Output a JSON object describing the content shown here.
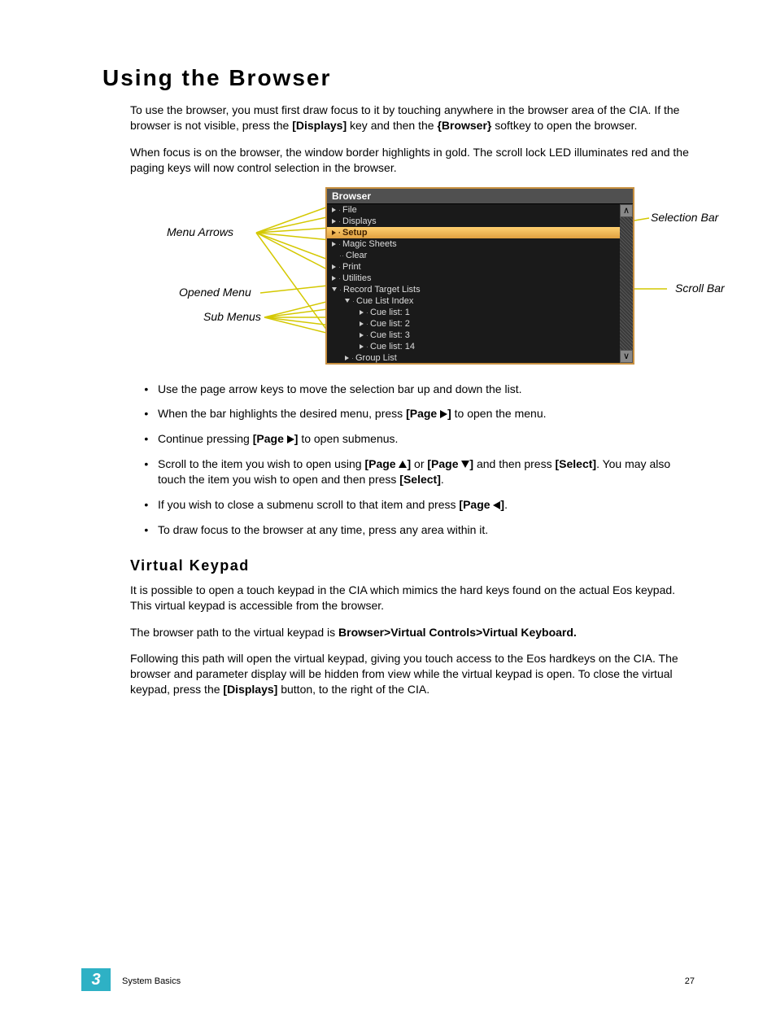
{
  "heading": "Using the Browser",
  "para1_a": "To use the browser, you must first draw focus to it by touching anywhere in the browser area of the CIA. If the browser is not visible, press the ",
  "para1_b": "[Displays]",
  "para1_c": " key and then the ",
  "para1_d": "{Browser}",
  "para1_e": " softkey to open the browser.",
  "para2": "When focus is on the browser, the window border highlights in gold. The scroll lock LED illuminates red and the paging keys will now control selection in the browser.",
  "callouts": {
    "menu_arrows": "Menu Arrows",
    "opened_menu": "Opened Menu",
    "sub_menus": "Sub Menus",
    "selection_bar": "Selection Bar",
    "scroll_bar": "Scroll Bar"
  },
  "browser": {
    "title": "Browser",
    "rows": [
      "File",
      "Displays",
      "Setup",
      "Magic Sheets",
      "Clear",
      "Print",
      "Utilities",
      "Record Target Lists",
      "Cue List Index",
      "Cue list: 1",
      "Cue list: 2",
      "Cue list: 3",
      "Cue list: 14",
      "Group List"
    ]
  },
  "bullets": {
    "b1": "Use the page arrow keys to move the selection bar up and down the list.",
    "b2_a": "When the bar highlights the desired menu, press ",
    "b2_b": "[Page ",
    "b2_c": "]",
    "b2_d": " to open the menu.",
    "b3_a": "Continue pressing ",
    "b3_b": "[Page ",
    "b3_c": "]",
    "b3_d": " to open submenus.",
    "b4_a": "Scroll to the item you wish to open using ",
    "b4_b": "[Page ",
    "b4_c": "]",
    "b4_d": " or ",
    "b4_e": "[Page ",
    "b4_f": "]",
    "b4_g": " and then press ",
    "b4_h": "[Select]",
    "b4_i": ". You may also touch the item you wish to open and then press ",
    "b4_j": "[Select]",
    "b4_k": ".",
    "b5_a": "If you wish to close a submenu scroll to that item and press ",
    "b5_b": "[Page ",
    "b5_c": "]",
    "b5_d": ".",
    "b6": "To draw focus to the browser at any time, press any area within it."
  },
  "sub_heading": "Virtual Keypad",
  "vk_p1": "It is possible to open a touch keypad in the CIA which mimics the hard keys found on the actual Eos keypad. This virtual keypad is accessible from the browser.",
  "vk_p2_a": "The browser path to the virtual keypad is ",
  "vk_p2_b": "Browser>Virtual Controls>Virtual Keyboard.",
  "vk_p3_a": "Following this path will open the virtual keypad, giving you touch access to the Eos hardkeys on the CIA. The browser and parameter display will be hidden from view while the virtual keypad is open. To close the virtual keypad, press the ",
  "vk_p3_b": "[Displays]",
  "vk_p3_c": " button, to the right of the CIA.",
  "footer": {
    "chapter": "3",
    "section": "System Basics",
    "page": "27"
  }
}
